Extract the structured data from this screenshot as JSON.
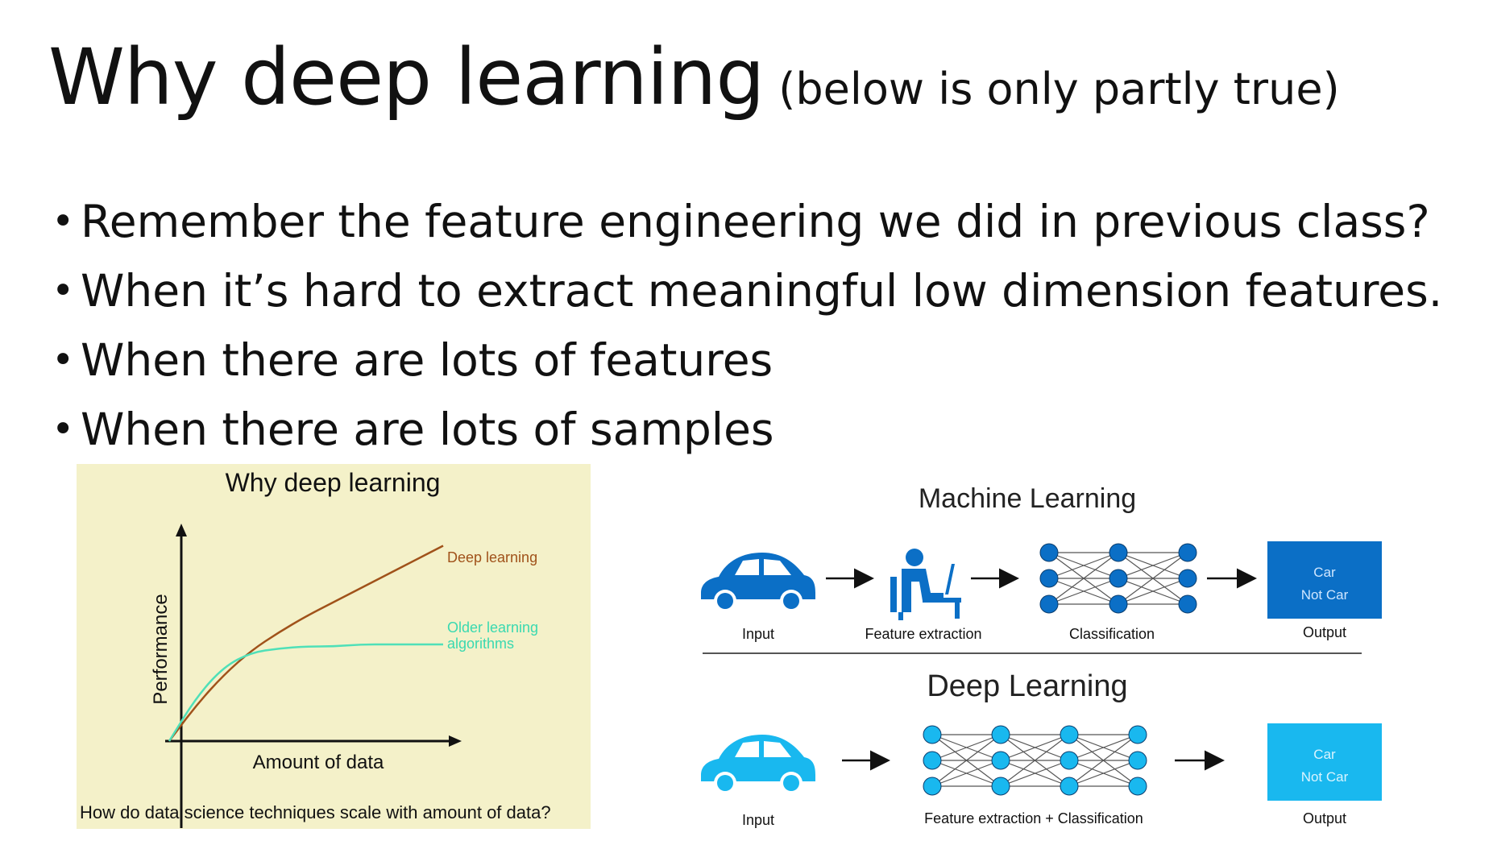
{
  "slide": {
    "title": "Why deep learning",
    "subtitle": "(below is only partly true)",
    "bullets": [
      "Remember the feature engineering we did in previous class?",
      "When it’s hard to extract meaningful low dimension features.",
      "When there are lots of features",
      "When there are lots of samples"
    ],
    "bullet_glyph": "•"
  },
  "chart_data": {
    "type": "line",
    "title": "Why deep learning",
    "xlabel": "Amount of data",
    "ylabel": "Performance",
    "caption": "How do data science techniques scale with amount of data?",
    "x": [
      0,
      0.1,
      0.2,
      0.3,
      0.4,
      0.5,
      0.6,
      0.7,
      0.8,
      0.9,
      1.0
    ],
    "series": [
      {
        "name": "Deep learning",
        "color": "#a0521a",
        "values": [
          0.0,
          0.18,
          0.33,
          0.45,
          0.54,
          0.62,
          0.69,
          0.76,
          0.83,
          0.9,
          0.97
        ]
      },
      {
        "name": "Older learning algorithms",
        "color": "#4fe0b8",
        "values": [
          0.0,
          0.22,
          0.37,
          0.44,
          0.46,
          0.47,
          0.47,
          0.48,
          0.48,
          0.48,
          0.48
        ]
      }
    ],
    "grid": false,
    "legend": "inline-right"
  },
  "diagram": {
    "ml": {
      "heading": "Machine Learning",
      "labels": [
        "Input",
        "Feature extraction",
        "Classification",
        "Output"
      ],
      "output_lines": [
        "Car",
        "Not Car"
      ],
      "color": "#0b6fc6"
    },
    "dl": {
      "heading": "Deep Learning",
      "labels": [
        "Input",
        "Feature extraction + Classification",
        "Output"
      ],
      "output_lines": [
        "Car",
        "Not Car"
      ],
      "color": "#19b8ef"
    },
    "icons": [
      "car-icon",
      "person-at-desk-icon",
      "neural-network-icon",
      "arrow-right-icon"
    ]
  }
}
